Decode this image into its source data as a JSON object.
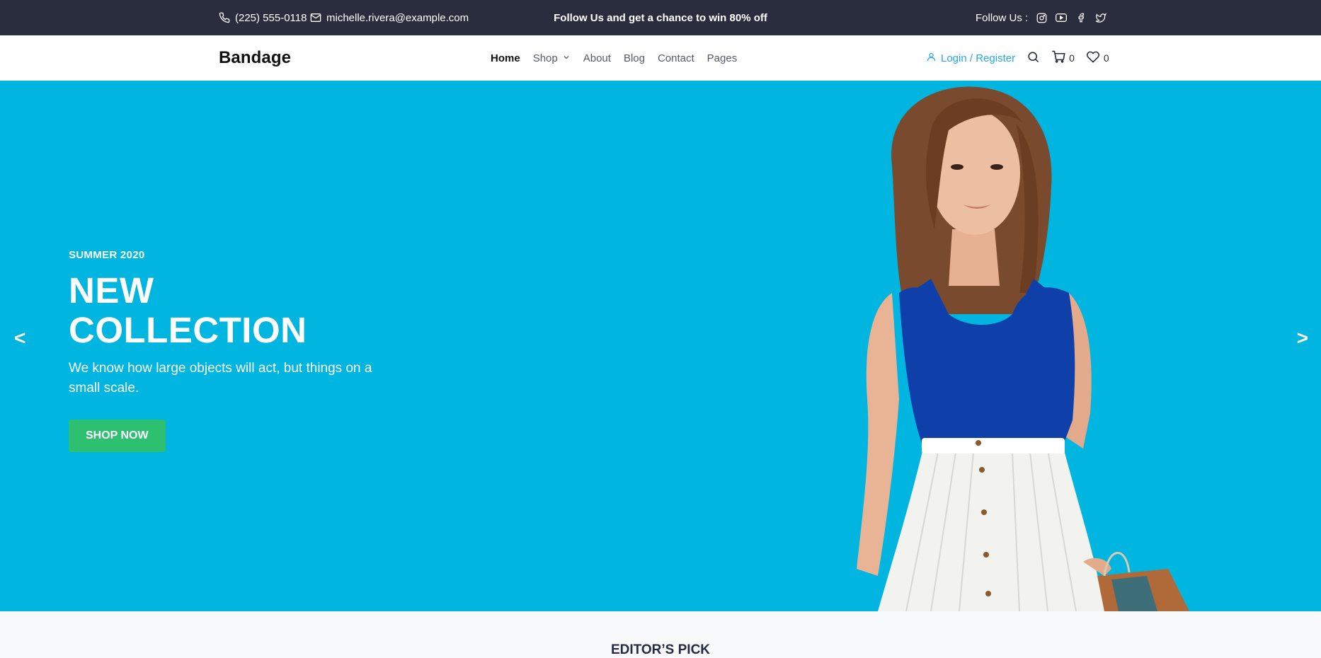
{
  "topbar": {
    "phone": "(225) 555-0118",
    "email": "michelle.rivera@example.com",
    "promo": "Follow Us  and get a chance to win 80% off",
    "follow_label": "Follow Us  :",
    "social_icons": [
      "instagram-icon",
      "youtube-icon",
      "facebook-icon",
      "twitter-icon"
    ],
    "background": "#2A2D3E"
  },
  "nav": {
    "brand": "Bandage",
    "menu": [
      {
        "label": "Home",
        "active": true
      },
      {
        "label": "Shop",
        "has_dropdown": true
      },
      {
        "label": "About"
      },
      {
        "label": "Blog"
      },
      {
        "label": "Contact"
      },
      {
        "label": "Pages"
      }
    ],
    "login_label": "Login / Register",
    "cart_count": "0",
    "wishlist_count": "0",
    "accent_color": "#23A6F0"
  },
  "hero": {
    "season": "SUMMER 2020",
    "headline_line1": "NEW",
    "headline_line2": "COLLECTION",
    "subtext": "We know how large objects will act, but things on a small scale.",
    "cta_label": "SHOP NOW",
    "prev_arrow": "<",
    "next_arrow": ">",
    "background": "#00B5DF",
    "cta_color": "#2DC071"
  },
  "editors_pick": {
    "title": "EDITOR’S PICK"
  }
}
